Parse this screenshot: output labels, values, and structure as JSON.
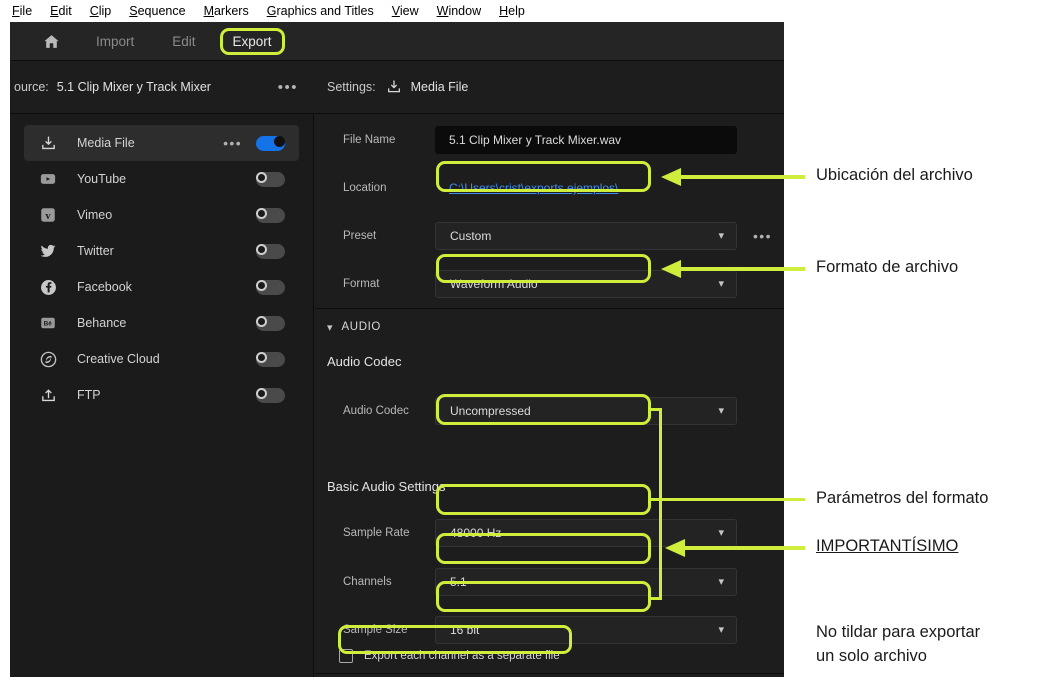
{
  "menubar": {
    "items": [
      {
        "mnemonic": "F",
        "rest": "ile"
      },
      {
        "mnemonic": "E",
        "rest": "dit"
      },
      {
        "mnemonic": "C",
        "rest": "lip"
      },
      {
        "mnemonic": "S",
        "rest": "equence"
      },
      {
        "mnemonic": "M",
        "rest": "arkers"
      },
      {
        "mnemonic": "G",
        "rest": "raphics and Titles"
      },
      {
        "mnemonic": "V",
        "rest": "iew"
      },
      {
        "mnemonic": "W",
        "rest": "indow"
      },
      {
        "mnemonic": "H",
        "rest": "elp"
      }
    ]
  },
  "tabs": {
    "home_icon": "home-icon",
    "import_label": "Import",
    "edit_label": "Edit",
    "export_label": "Export"
  },
  "source": {
    "label": "ource:",
    "value": "5.1 Clip Mixer y Track Mixer",
    "more_label": "•••"
  },
  "sidebar": {
    "destinations": [
      {
        "icon": "media-file-icon",
        "label": "Media File",
        "toggle": "on",
        "more": "•••"
      },
      {
        "icon": "youtube-icon",
        "label": "YouTube",
        "toggle": "off",
        "more": ""
      },
      {
        "icon": "vimeo-icon",
        "label": "Vimeo",
        "toggle": "off",
        "more": ""
      },
      {
        "icon": "twitter-icon",
        "label": "Twitter",
        "toggle": "off",
        "more": ""
      },
      {
        "icon": "facebook-icon",
        "label": "Facebook",
        "toggle": "off",
        "more": ""
      },
      {
        "icon": "behance-icon",
        "label": "Behance",
        "toggle": "off",
        "more": ""
      },
      {
        "icon": "creative-cloud-icon",
        "label": "Creative Cloud",
        "toggle": "off",
        "more": ""
      },
      {
        "icon": "ftp-icon",
        "label": "FTP",
        "toggle": "off",
        "more": ""
      }
    ]
  },
  "settings": {
    "header_label": "Settings:",
    "header_icon": "media-file-icon",
    "header_value": "Media File",
    "fields": {
      "file_name_label": "File Name",
      "file_name_value": "5.1 Clip Mixer y Track Mixer.wav",
      "location_label": "Location",
      "location_value": "C:\\Users\\crist\\exports ejemplos\\",
      "preset_label": "Preset",
      "preset_value": "Custom",
      "preset_more": "•••",
      "format_label": "Format",
      "format_value": "Waveform Audio"
    },
    "audio_section": {
      "header": "AUDIO",
      "chevron": "chevron-down-icon",
      "codec_group_title": "Audio Codec",
      "codec_label": "Audio Codec",
      "codec_value": "Uncompressed",
      "basic_group_title": "Basic Audio Settings",
      "sample_rate_label": "Sample Rate",
      "sample_rate_value": "48000 Hz",
      "channels_label": "Channels",
      "channels_value": "5.1",
      "sample_size_label": "Sample Size",
      "sample_size_value": "16 bit",
      "checkbox_label": "Export each channel as a separate file",
      "checkbox_checked": "false"
    }
  },
  "annotations": [
    {
      "id": "location-note",
      "text": "Ubicación del archivo",
      "underline": "false"
    },
    {
      "id": "format-note",
      "text": "Formato de archivo",
      "underline": "false"
    },
    {
      "id": "params-note",
      "text": "Parámetros del formato",
      "underline": "false"
    },
    {
      "id": "important-note",
      "text": "IMPORTANTÍSIMO",
      "underline": "true"
    },
    {
      "id": "checkbox-note-1",
      "text": "No tildar para exportar",
      "underline": "false"
    },
    {
      "id": "checkbox-note-2",
      "text": "un solo archivo",
      "underline": "false"
    }
  ],
  "colors": {
    "highlight": "#cfee3b",
    "toggle_on": "#1473e6",
    "link": "#3d8ef0",
    "panel_bg": "#1d1d1d"
  }
}
